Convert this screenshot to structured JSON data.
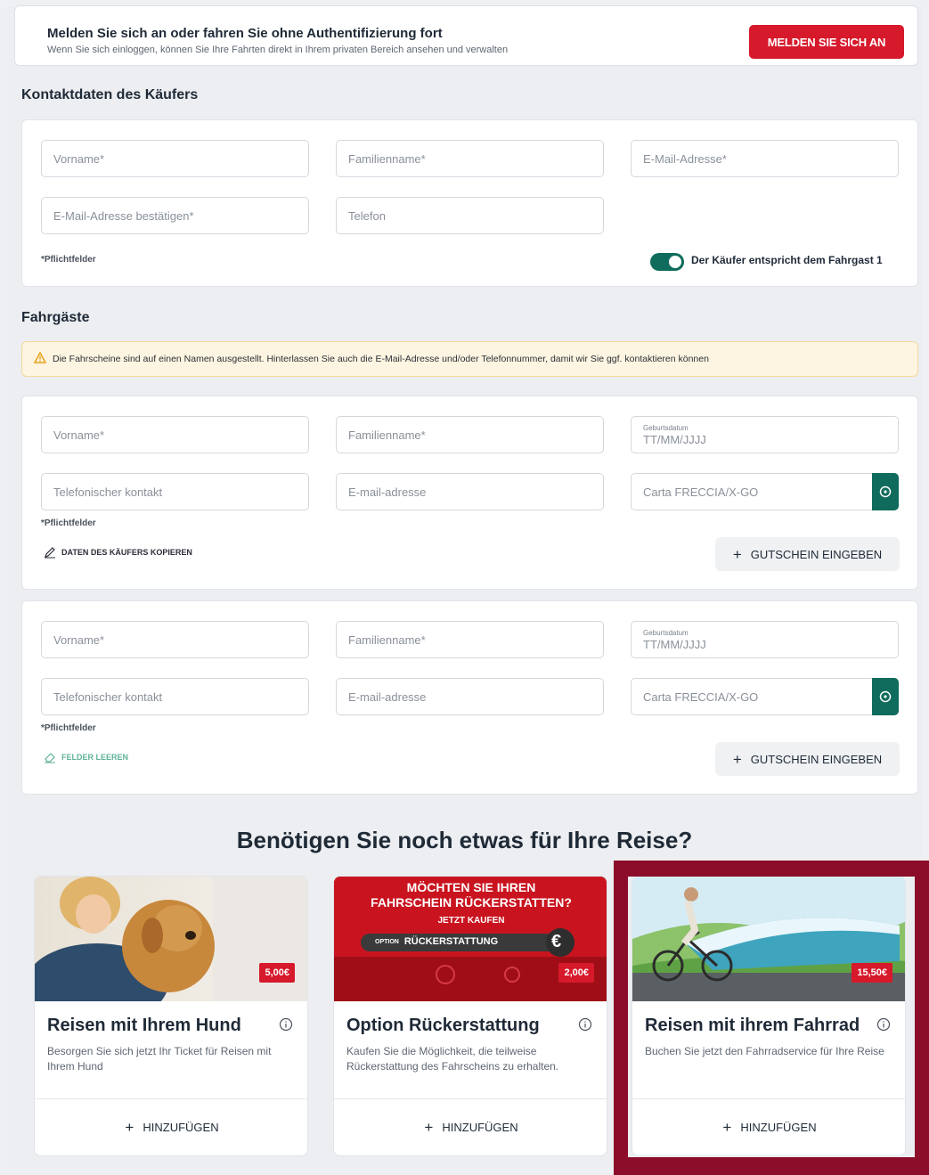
{
  "login": {
    "title": "Melden Sie sich an oder fahren Sie ohne Authentifizierung fort",
    "subtitle": "Wenn Sie sich einloggen, können Sie Ihre Fahrten direkt in Ihrem privaten Bereich ansehen und verwalten",
    "button": "MELDEN SIE SICH AN"
  },
  "buyer": {
    "section_title": "Kontaktdaten des Käufers",
    "fields": {
      "firstname": "Vorname*",
      "lastname": "Familienname*",
      "email": "E-Mail-Adresse*",
      "email_confirm": "E-Mail-Adresse bestätigen*",
      "phone": "Telefon"
    },
    "required_note": "*Pflichtfelder",
    "toggle_label": "Der Käufer entspricht dem Fahrgast 1",
    "toggle_on": true
  },
  "passengers": {
    "section_title": "Fahrgäste",
    "warning": "Die Fahrscheine sind auf einen Namen ausgestellt. Hinterlassen Sie auch die E-Mail-Adresse und/oder Telefonnummer, damit wir Sie ggf. kontaktieren können",
    "list": [
      {
        "firstname": "Vorname*",
        "lastname": "Familienname*",
        "dob_label": "Geburtsdatum",
        "dob_placeholder": "TT/MM/JJJJ",
        "phone": "Telefonischer kontakt",
        "email": "E-mail-adresse",
        "carta": "Carta FRECCIA/X-GO",
        "required_note": "*Pflichtfelder",
        "link": "DATEN DES KÄUFERS KOPIEREN",
        "voucher": "GUTSCHEIN EINGEBEN"
      },
      {
        "firstname": "Vorname*",
        "lastname": "Familienname*",
        "dob_label": "Geburtsdatum",
        "dob_placeholder": "TT/MM/JJJJ",
        "phone": "Telefonischer kontakt",
        "email": "E-mail-adresse",
        "carta": "Carta FRECCIA/X-GO",
        "required_note": "*Pflichtfelder",
        "link": "FELDER LEEREN",
        "voucher": "GUTSCHEIN EINGEBEN"
      }
    ]
  },
  "extras": {
    "headline": "Benötigen Sie noch etwas für Ihre Reise?",
    "offers": [
      {
        "title": "Reisen mit Ihrem Hund",
        "desc": "Besorgen Sie sich jetzt Ihr Ticket für Reisen mit Ihrem Hund",
        "price": "5,00€",
        "add": "HINZUFÜGEN"
      },
      {
        "title": "Option Rückerstattung",
        "desc": "Kaufen Sie die Möglichkeit, die teilweise Rückerstattung des Fahrscheins zu erhalten.",
        "price": "2,00€",
        "add": "HINZUFÜGEN",
        "banner_line1": "MÖCHTEN SIE IHREN",
        "banner_line2": "FAHRSCHEIN RÜCKERSTATTEN?",
        "banner_cta": "JETZT KAUFEN",
        "banner_option": "OPTION",
        "banner_refund": "RÜCKERSTATTUNG"
      },
      {
        "title": "Reisen mit ihrem Fahrrad",
        "desc": "Buchen Sie jetzt den Fahrradservice für Ihre Reise",
        "price": "15,50€",
        "add": "HINZUFÜGEN"
      }
    ]
  },
  "colors": {
    "brand_red": "#d6192b",
    "teal": "#0f6b5c",
    "highlight": "#8b0d2a"
  }
}
